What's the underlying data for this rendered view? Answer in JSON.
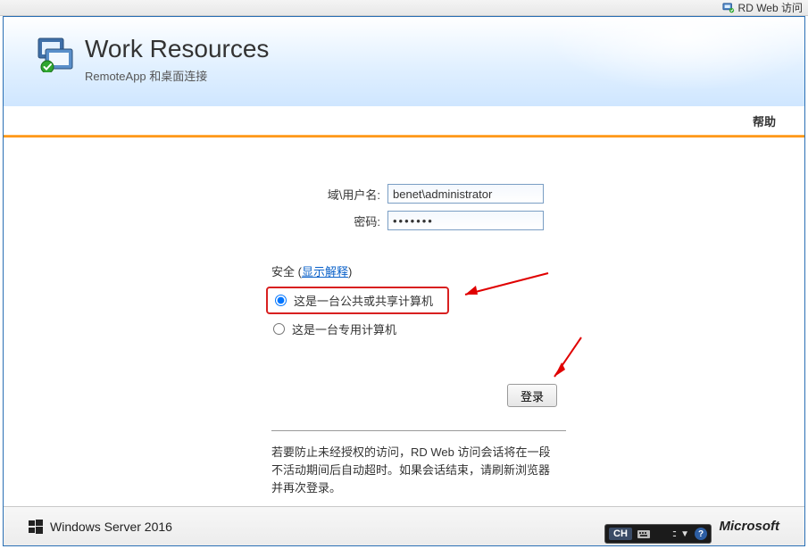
{
  "window_title": "RD Web 访问",
  "header": {
    "title": "Work Resources",
    "subtitle": "RemoteApp 和桌面连接"
  },
  "help_label": "帮助",
  "form": {
    "username_label": "域\\用户名:",
    "username_value": "benet\\administrator",
    "password_label": "密码:",
    "password_value": "•••••••"
  },
  "security": {
    "title_prefix": "安全 (",
    "explain_link": "显示解释",
    "title_suffix": ")",
    "option_public": "这是一台公共或共享计算机",
    "option_private": "这是一台专用计算机"
  },
  "login_button": "登录",
  "footnote": "若要防止未经授权的访问，RD Web 访问会话将在一段不活动期间后自动超时。如果会话结束，请刷新浏览器并再次登录。",
  "footer": {
    "product": "Windows Server 2016",
    "vendor": "Microsoft"
  },
  "ime": {
    "lang_badge": "CH",
    "dots": ":::",
    "help": "?"
  }
}
